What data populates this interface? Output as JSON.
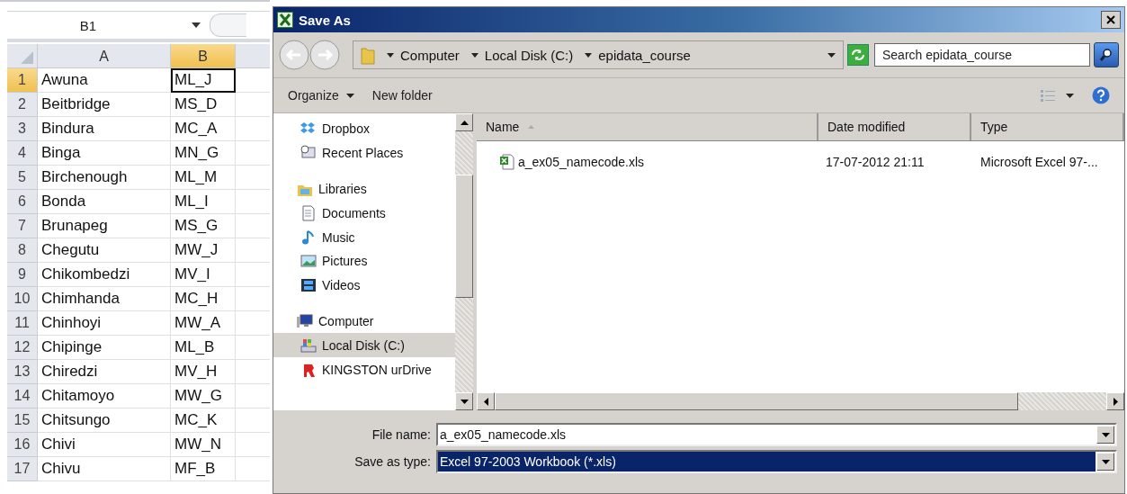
{
  "sheet": {
    "name_box": "B1",
    "columns": [
      {
        "label": "A",
        "selected": false
      },
      {
        "label": "B",
        "selected": true
      }
    ],
    "rows": [
      {
        "number": "1",
        "cells": [
          "Awuna",
          "ML_J"
        ],
        "selected": true
      },
      {
        "number": "2",
        "cells": [
          "Beitbridge",
          "MS_D"
        ],
        "selected": false
      },
      {
        "number": "3",
        "cells": [
          "Bindura",
          "MC_A"
        ],
        "selected": false
      },
      {
        "number": "4",
        "cells": [
          "Binga",
          "MN_G"
        ],
        "selected": false
      },
      {
        "number": "5",
        "cells": [
          "Birchenough",
          "ML_M"
        ],
        "selected": false
      },
      {
        "number": "6",
        "cells": [
          "Bonda",
          "ML_I"
        ],
        "selected": false
      },
      {
        "number": "7",
        "cells": [
          "Brunapeg",
          "MS_G"
        ],
        "selected": false
      },
      {
        "number": "8",
        "cells": [
          "Chegutu",
          "MW_J"
        ],
        "selected": false
      },
      {
        "number": "9",
        "cells": [
          "Chikombedzi",
          "MV_I"
        ],
        "selected": false
      },
      {
        "number": "10",
        "cells": [
          "Chimhanda",
          "MC_H"
        ],
        "selected": false
      },
      {
        "number": "11",
        "cells": [
          "Chinhoyi",
          "MW_A"
        ],
        "selected": false
      },
      {
        "number": "12",
        "cells": [
          "Chipinge",
          "ML_B"
        ],
        "selected": false
      },
      {
        "number": "13",
        "cells": [
          "Chiredzi",
          "MV_H"
        ],
        "selected": false
      },
      {
        "number": "14",
        "cells": [
          "Chitamoyo",
          "MW_G"
        ],
        "selected": false
      },
      {
        "number": "15",
        "cells": [
          "Chitsungo",
          "MC_K"
        ],
        "selected": false
      },
      {
        "number": "16",
        "cells": [
          "Chivi",
          "MW_N"
        ],
        "selected": false
      },
      {
        "number": "17",
        "cells": [
          "Chivu",
          "MF_B"
        ],
        "selected": false
      }
    ]
  },
  "dialog": {
    "title": "Save As",
    "breadcrumb": [
      "Computer",
      "Local Disk (C:)",
      "epidata_course"
    ],
    "search": {
      "placeholder": "Search epidata_course"
    },
    "toolbar": [
      "Organize",
      "New folder"
    ],
    "nav_items": [
      {
        "label": "Dropbox",
        "kind": "dropbox",
        "group": false,
        "selected": false
      },
      {
        "label": "Recent Places",
        "kind": "recent",
        "group": false,
        "selected": false
      },
      {
        "label": "Libraries",
        "kind": "libraries",
        "group": true,
        "selected": false
      },
      {
        "label": "Documents",
        "kind": "documents",
        "group": false,
        "selected": false
      },
      {
        "label": "Music",
        "kind": "music",
        "group": false,
        "selected": false
      },
      {
        "label": "Pictures",
        "kind": "pictures",
        "group": false,
        "selected": false
      },
      {
        "label": "Videos",
        "kind": "videos",
        "group": false,
        "selected": false
      },
      {
        "label": "Computer",
        "kind": "computer",
        "group": true,
        "selected": false
      },
      {
        "label": "Local Disk (C:)",
        "kind": "disk",
        "group": false,
        "selected": true
      },
      {
        "label": "KINGSTON urDrive",
        "kind": "usb",
        "group": false,
        "selected": false
      }
    ],
    "columns": [
      "Name",
      "Date modified",
      "Type"
    ],
    "files": [
      {
        "name": "a_ex05_namecode.xls",
        "date": "17-07-2012 21:11",
        "type": "Microsoft Excel 97-..."
      }
    ],
    "file_name_label": "File name:",
    "file_name": "a_ex05_namecode.xls",
    "save_type_label": "Save as type:",
    "save_type": "Excel 97-2003 Workbook (*.xls)"
  }
}
